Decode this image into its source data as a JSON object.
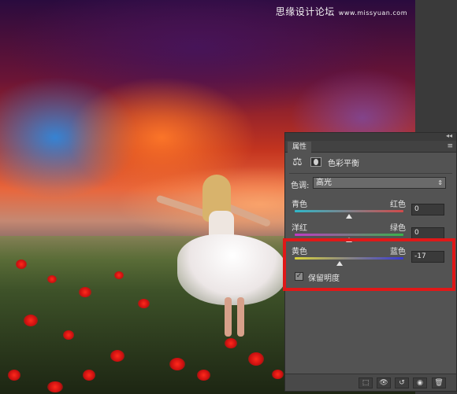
{
  "watermark": {
    "text": "思缘设计论坛",
    "site": "www.missyuan.com"
  },
  "panel": {
    "collapse_icon": "◂◂",
    "tab_label": "属性",
    "menu_icon": "≡",
    "title": "色彩平衡",
    "balance_icon": "⚖",
    "tone": {
      "label": "色调:",
      "value": "高光",
      "arrows": "⇕"
    },
    "sliders": [
      {
        "left": "青色",
        "right": "红色",
        "value": "0",
        "level": 0,
        "track_colors": [
          "#2fb8c9",
          "#d24a4a"
        ]
      },
      {
        "left": "洋红",
        "right": "绿色",
        "value": "0",
        "level": 0,
        "track_colors": [
          "#c13ac4",
          "#38b34a"
        ]
      },
      {
        "left": "黄色",
        "right": "蓝色",
        "value": "-17",
        "level": -17,
        "track_colors": [
          "#d8d23a",
          "#3a3ad0"
        ]
      }
    ],
    "slider_range": [
      -100,
      100
    ],
    "preserve": {
      "label": "保留明度",
      "checked": true,
      "check_mark": "✓"
    },
    "footer_icons": {
      "clip": "⬚",
      "view": "👁",
      "reset": "↺",
      "visibility": "◉",
      "delete": "🗑"
    }
  },
  "colors": {
    "highlight_border": "#e01818",
    "panel_bg": "#535353"
  }
}
